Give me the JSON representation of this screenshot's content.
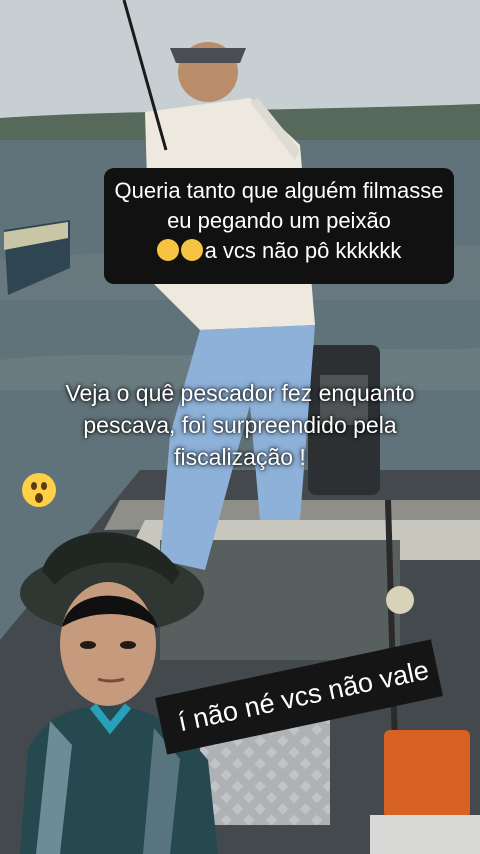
{
  "caption": {
    "line1": "Queria tanto que alguém filmasse",
    "line2": "eu pegando um peixão",
    "line3": "a vcs não pô kkkkkk"
  },
  "overlay": {
    "line1": "Veja o quê  pescador fez enquanto",
    "line2": "pescava, foi surpreendido pela",
    "line3": "fiscalização !"
  },
  "sticker": {
    "text": "í não né vcs não vale"
  },
  "colors": {
    "water": "#5e7178",
    "sky": "#b9c3c8",
    "shirt": "#e9e6df",
    "jeans": "#8fb2d8",
    "caption_bg": "#111111"
  }
}
